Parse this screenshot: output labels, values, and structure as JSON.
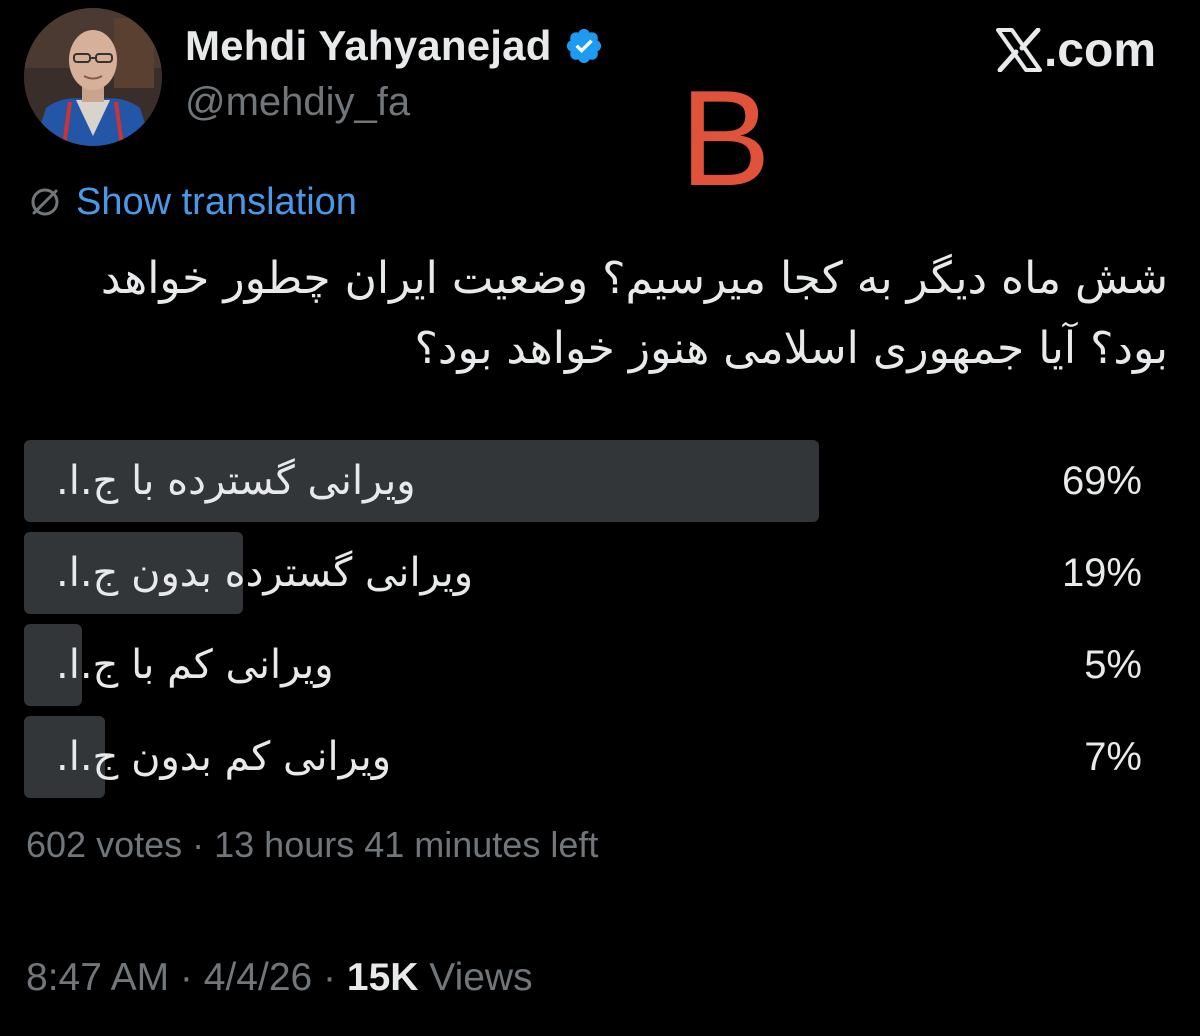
{
  "colors": {
    "background": "#000000",
    "text_primary": "#e7e9ea",
    "text_secondary": "#71767b",
    "link": "#4a99e9",
    "verified_badge": "#1d9bf0",
    "poll_bar": "#333639",
    "overlay_letter": "#e0533a"
  },
  "header": {
    "display_name": "Mehdi Yahyanejad",
    "handle": "@mehdiy_fa",
    "verified_icon": "verified-badge-icon",
    "avatar_icon": "profile-photo"
  },
  "site_mark": {
    "logo_icon": "x-logo-icon",
    "domain": ".com"
  },
  "overlay_letter": "B",
  "translation": {
    "icon": "globe-off-icon",
    "label": "Show translation"
  },
  "tweet": {
    "text": "شش ماه دیگر به کجا میرسیم؟ وضعیت ایران چطور خواهد بود؟ آیا جمهوری اسلامی هنوز خواهد بود؟"
  },
  "poll": {
    "options": [
      {
        "label": "ویرانی گسترده با ج.ا.",
        "percent_text": "69%",
        "percent": 69
      },
      {
        "label": "ویرانی گسترده بدون ج.ا.",
        "percent_text": "19%",
        "percent": 19
      },
      {
        "label": "ویرانی کم با ج.ا.",
        "percent_text": "5%",
        "percent": 5
      },
      {
        "label": "ویرانی کم بدون ج.ا.",
        "percent_text": "7%",
        "percent": 7
      }
    ],
    "votes": "602 votes",
    "separator": " · ",
    "time_left": "13 hours 41 minutes left"
  },
  "footer": {
    "time": "8:47 AM",
    "date": "4/4/26",
    "separator": " · ",
    "views_count": "15K",
    "views_label": "Views"
  }
}
